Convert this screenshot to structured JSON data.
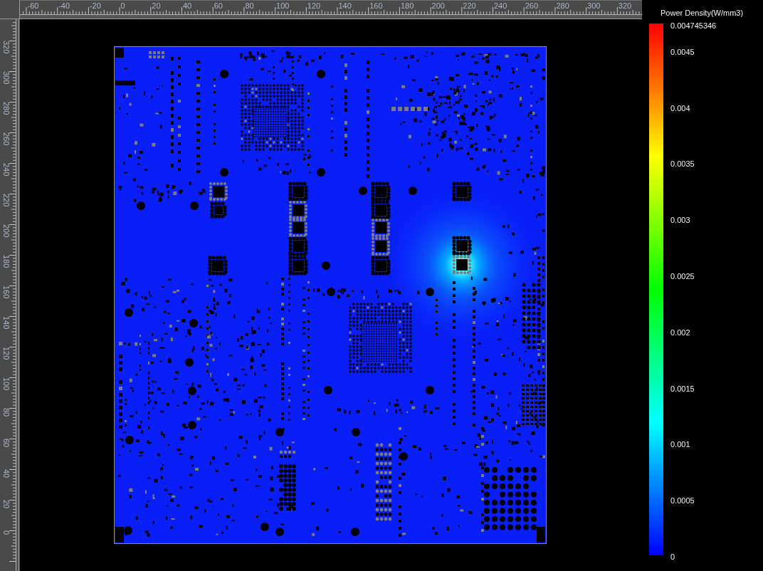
{
  "top_ruler": {
    "labels": [
      "-60",
      "-40",
      "-20",
      "0",
      "20",
      "40",
      "60",
      "80",
      "100",
      "120",
      "140",
      "160",
      "180",
      "200",
      "220",
      "240",
      "260",
      "280",
      "300",
      "320"
    ]
  },
  "left_ruler": {
    "labels": [
      "320",
      "300",
      "280",
      "260",
      "240",
      "220",
      "200",
      "180",
      "160",
      "140",
      "120",
      "100",
      "80",
      "60",
      "40",
      "20",
      "0"
    ]
  },
  "color_legend": {
    "title": "Power Density(W/mm3)",
    "labels": [
      "0.004745346",
      "0.0045",
      "0.004",
      "0.0035",
      "0.003",
      "0.0025",
      "0.002",
      "0.0015",
      "0.001",
      "0.0005",
      "0"
    ]
  }
}
